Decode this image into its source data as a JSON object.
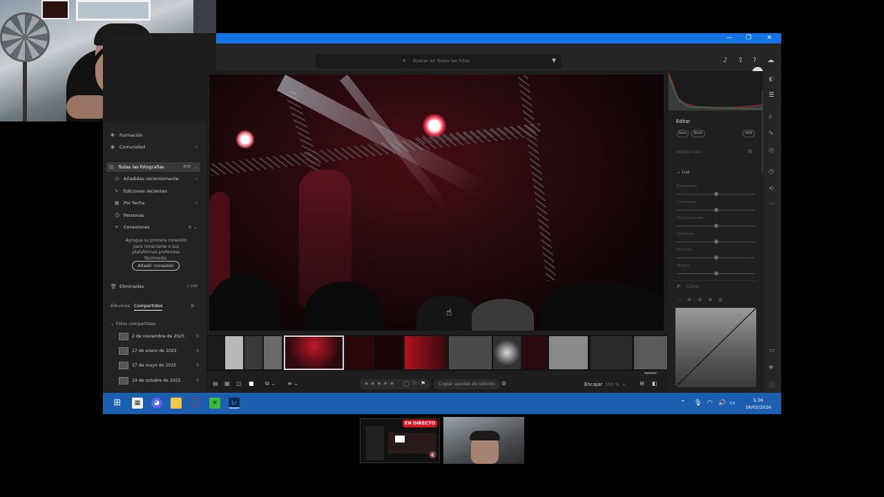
{
  "search": {
    "placeholder": "Buscar en Todas las fotos"
  },
  "sidebar": {
    "items": [
      {
        "label": "Formación",
        "icon": "lightbulb-icon"
      },
      {
        "label": "Comunidad",
        "icon": "globe-icon"
      }
    ],
    "all_photos": {
      "label": "Todas las fotografías",
      "count": "670"
    },
    "sub_items": [
      {
        "label": "Añadidas recientemente",
        "icon": "clock-icon"
      },
      {
        "label": "Ediciones recientes",
        "icon": "edit-icon"
      },
      {
        "label": "Por fecha",
        "icon": "calendar-icon"
      },
      {
        "label": "Personas",
        "icon": "person-icon"
      },
      {
        "label": "Conexiones",
        "icon": "connections-icon"
      }
    ],
    "help_text": "Agregue su primera conexión para conectarse a sus plataformas preferidas fácilmente.",
    "add_connection": "Añadir conexión",
    "deleted": {
      "label": "Eliminadas",
      "count": "1.196"
    },
    "tabs": {
      "albums": "Álbumes",
      "shared": "Compartidos"
    },
    "shared_header": "Fotos compartidas",
    "shared_items": [
      {
        "label": "2 de noviembre de 2025",
        "count": "0"
      },
      {
        "label": "17 de enero de 2025",
        "count": "0"
      },
      {
        "label": "17 de mayo de 2025",
        "count": "0"
      },
      {
        "label": "19 de octubre de 2025",
        "count": "0"
      }
    ]
  },
  "bottombar": {
    "copy_settings": "Copiar ajustes de edición",
    "fit": "Encajar",
    "zoom": "100 %"
  },
  "rightpanel": {
    "title": "Editar",
    "pills": [
      "Auto",
      "B&W",
      "HDR"
    ],
    "profile": "Adobe Color",
    "section": "Luz",
    "sliders": [
      "Exposición",
      "Contraste",
      "Iluminaciones",
      "Sombras",
      "Blancos",
      "Negros"
    ],
    "curve": "Curva"
  },
  "taskbar": {
    "time": "5:36",
    "date": "18/02/2026"
  },
  "preview": {
    "live": "EN DIRECTO"
  },
  "colors": {
    "accent": "#1473e6",
    "taskbar": "#1c5fb0",
    "live": "#e1131e"
  }
}
